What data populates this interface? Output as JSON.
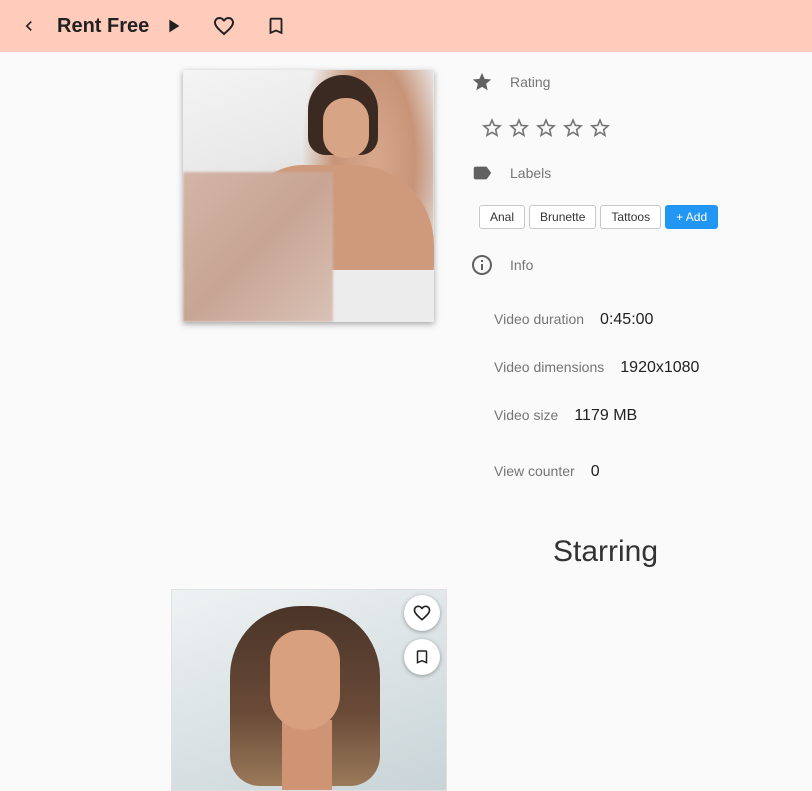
{
  "appbar": {
    "title": "Rent Free",
    "background": "#ffccbc",
    "icons": [
      "chevron-left-icon",
      "play-icon",
      "heart-outline-icon",
      "bookmark-outline-icon"
    ]
  },
  "rating": {
    "label": "Rating",
    "value": 0,
    "max": 5,
    "icon": "star-icon"
  },
  "labels": {
    "label": "Labels",
    "icon": "label-tag-icon",
    "items": [
      "Anal",
      "Brunette",
      "Tattoos"
    ],
    "add_label": "+ Add",
    "add_color": "#2196f3"
  },
  "info": {
    "label": "Info",
    "icon": "info-circle-icon",
    "rows": [
      {
        "key": "Video duration",
        "value": "0:45:00"
      },
      {
        "key": "Video dimensions",
        "value": "1920x1080"
      },
      {
        "key": "Video size",
        "value": "1179 MB"
      },
      {
        "key": "View counter",
        "value": "0"
      }
    ]
  },
  "starring": {
    "heading": "Starring",
    "card_icons": [
      "heart-outline-icon",
      "bookmark-outline-icon"
    ]
  }
}
